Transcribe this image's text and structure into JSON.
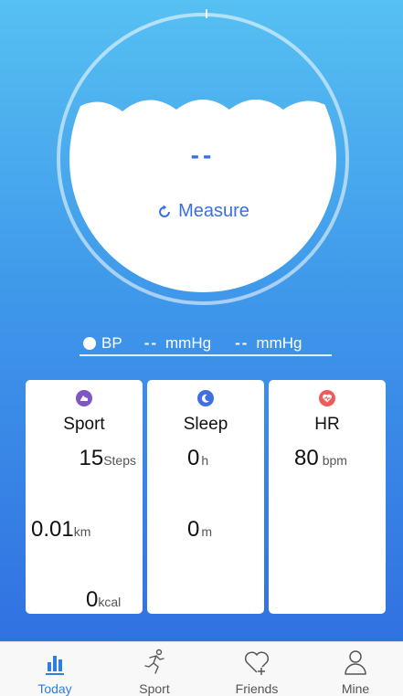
{
  "gauge": {
    "value": "--",
    "measure_label": "Measure"
  },
  "bp": {
    "label": "BP",
    "systolic": "--",
    "systolic_unit": "mmHg",
    "diastolic": "--",
    "diastolic_unit": "mmHg"
  },
  "cards": {
    "sport": {
      "title": "Sport",
      "icon": "running-shoe-icon",
      "icon_color": "#7e57c2",
      "steps": "15",
      "steps_unit": "Steps",
      "distance": "0.01",
      "distance_unit": "km",
      "calories": "0",
      "calories_unit": "kcal"
    },
    "sleep": {
      "title": "Sleep",
      "icon": "moon-icon",
      "icon_color": "#3f6fe0",
      "hours": "0",
      "hours_unit": "h",
      "minutes": "0",
      "minutes_unit": "m"
    },
    "hr": {
      "title": "HR",
      "icon": "heart-pulse-icon",
      "icon_color": "#ef5b5b",
      "value": "80",
      "unit": "bpm"
    }
  },
  "tabs": [
    {
      "label": "Today",
      "icon": "bar-chart-icon",
      "active": true
    },
    {
      "label": "Sport",
      "icon": "runner-icon",
      "active": false
    },
    {
      "label": "Friends",
      "icon": "heart-plus-icon",
      "active": false
    },
    {
      "label": "Mine",
      "icon": "person-icon",
      "active": false
    }
  ],
  "colors": {
    "gradient_top": "#56c0f2",
    "gradient_bottom": "#2f6be0",
    "accent": "#2f7fe0"
  }
}
